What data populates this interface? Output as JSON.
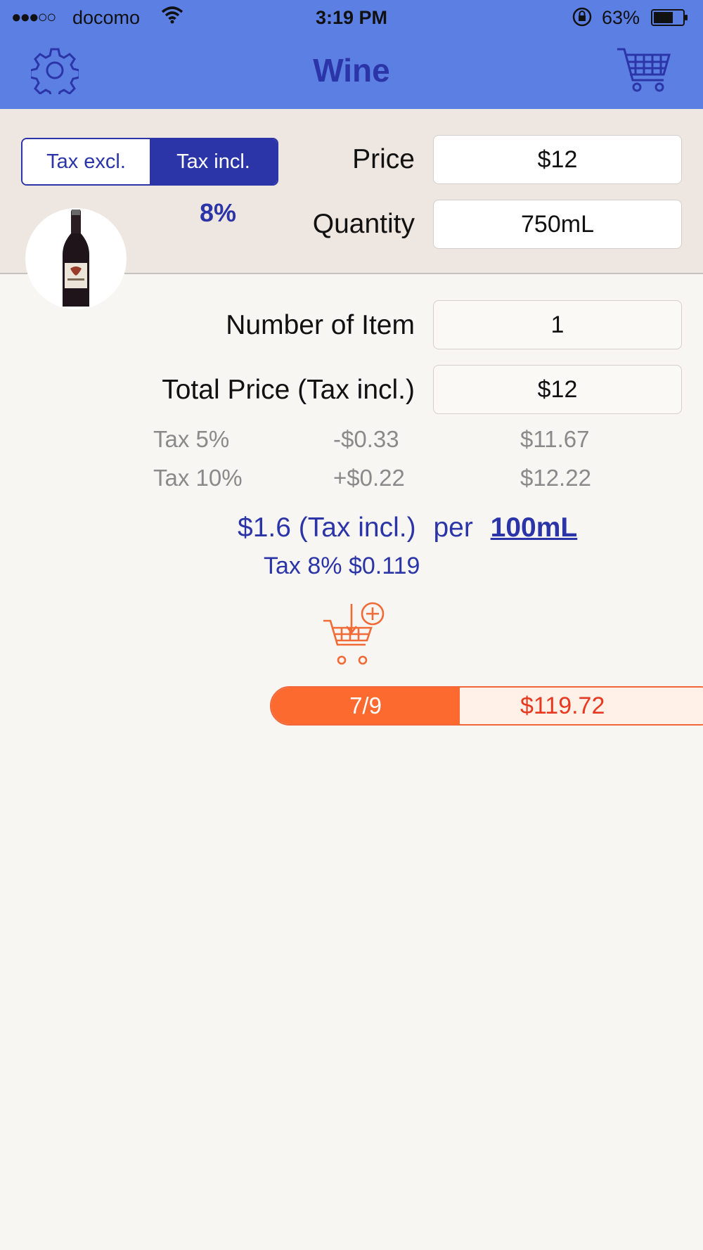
{
  "status_bar": {
    "signal": "●●●○○",
    "carrier": "docomo",
    "time": "3:19 PM",
    "battery_percent": "63%"
  },
  "nav": {
    "title": "Wine",
    "settings_icon": "gear-icon",
    "cart_icon": "cart-icon"
  },
  "tax_toggle": {
    "excl_label": "Tax excl.",
    "incl_label": "Tax incl.",
    "selected": "Tax incl.",
    "rate": "8%"
  },
  "form": {
    "price_label": "Price",
    "price_value": "$12",
    "quantity_label": "Quantity",
    "quantity_value": "750mL",
    "items_label": "Number of Item",
    "items_value": "1",
    "total_label": "Total Price (Tax incl.)",
    "total_value": "$12"
  },
  "tax_comparisons": [
    {
      "label": "Tax  5%",
      "diff": "-$0.33",
      "price": "$11.67"
    },
    {
      "label": "Tax  10%",
      "diff": "+$0.22",
      "price": "$12.22"
    }
  ],
  "unit_price": {
    "amount": "$1.6 (Tax incl.)",
    "per": "per",
    "unit": "100mL",
    "tax_line": "Tax 8% $0.119"
  },
  "add_to_cart_icon": "add-to-cart-icon",
  "cart_summary": {
    "count": "7/9",
    "total": "$119.72"
  },
  "colors": {
    "nav_bg": "#5c7fe4",
    "accent_blue": "#2b35a8",
    "accent_orange": "#fc6a30",
    "total_red": "#e8381f"
  }
}
